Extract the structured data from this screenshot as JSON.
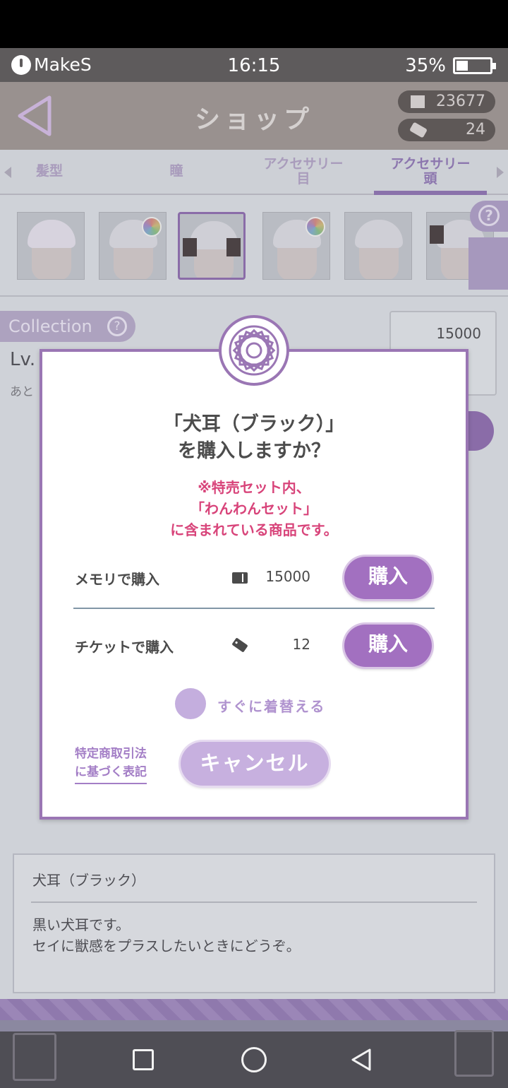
{
  "status_bar": {
    "brand": "MakeS",
    "time": "16:15",
    "battery": "35%"
  },
  "header": {
    "title": "ショップ",
    "memory_count": "23677",
    "ticket_count": "24"
  },
  "tabs": [
    {
      "line1": "髪型",
      "line2": ""
    },
    {
      "line1": "瞳",
      "line2": ""
    },
    {
      "line1": "アクセサリー",
      "line2": "目"
    },
    {
      "line1": "アクセサリー",
      "line2": "頭"
    }
  ],
  "collection": {
    "label": "Collection",
    "help": "?",
    "level_text": "Lv.",
    "remaining_text": "あと"
  },
  "price_box": {
    "memory_price": "15000"
  },
  "dialog": {
    "question_line1": "「犬耳（ブラック）」",
    "question_line2": "を購入しますか？",
    "note_line1": "※特売セット内、",
    "note_line2": "「わんわんセット」",
    "note_line3": "に含まれている商品です。",
    "memory_row": {
      "label": "メモリで購入",
      "price": "15000",
      "button": "購入"
    },
    "ticket_row": {
      "label": "チケットで購入",
      "price": "12",
      "button": "購入"
    },
    "wear_now": "すぐに着替える",
    "legal_line1": "特定商取引法",
    "legal_line2": "に基づく表記",
    "cancel": "キャンセル"
  },
  "description": {
    "name": "犬耳（ブラック）",
    "line1": "黒い犬耳です。",
    "line2": "セイに獣感をプラスしたいときにどうぞ。"
  },
  "colors": {
    "accent": "#a270c0",
    "note": "#d8447a",
    "border": "#9a76b4"
  }
}
